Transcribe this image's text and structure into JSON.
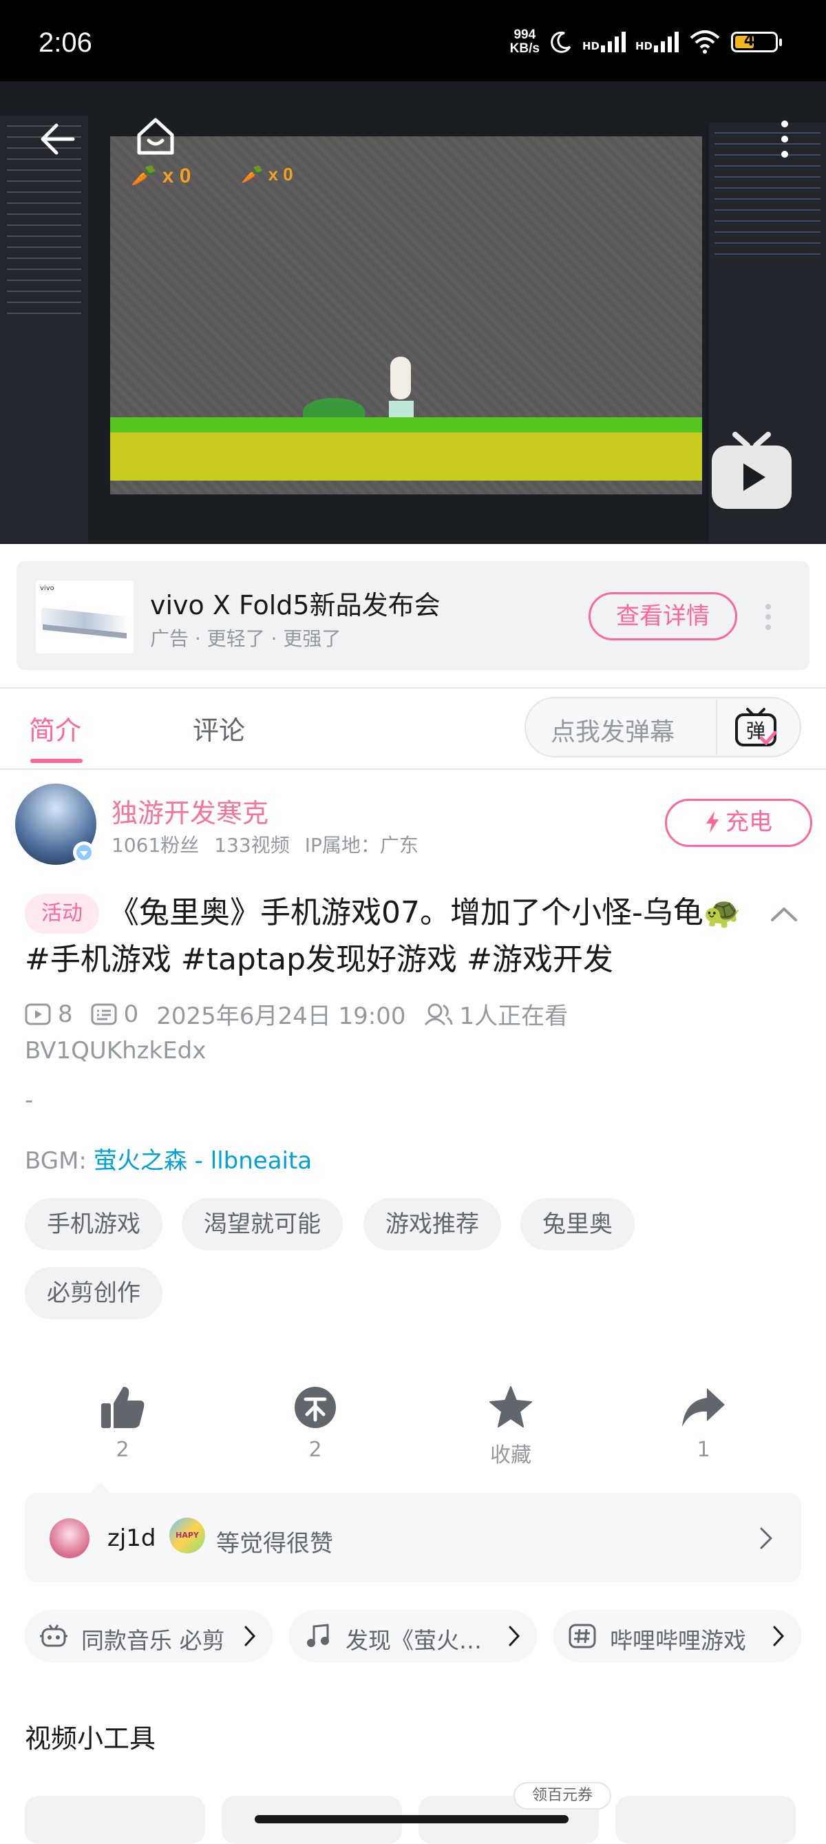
{
  "status_bar": {
    "time": "2:06",
    "net_speed_value": "994",
    "net_speed_unit": "KB/s",
    "hd1": "HD",
    "hd2": "HD",
    "battery": "43",
    "icons": [
      "moon-icon",
      "signal-icon",
      "signal-icon",
      "wifi-icon",
      "battery-icon"
    ]
  },
  "video_overlay": {
    "carrot_count_1": "x 0",
    "carrot_count_2": "x 0",
    "buttons": [
      "back-arrow-icon",
      "home-icon",
      "more-vertical-icon",
      "tv-play-icon"
    ]
  },
  "ad": {
    "title": "vivo X Fold5新品发布会",
    "subtitle": "广告 · 更轻了 · 更强了",
    "button": "查看详情",
    "thumb_label": "vivo"
  },
  "tabs": {
    "intro": "简介",
    "comments": "评论",
    "danmaku_placeholder": "点我发弹幕",
    "danmaku_icon_char": "弹"
  },
  "uploader": {
    "name": "独游开发寒克",
    "fans": "1061粉丝",
    "videos": "133视频",
    "ip": "IP属地：广东",
    "charge_label": "充电"
  },
  "video": {
    "tag": "活动",
    "title": "《兔里奥》手机游戏07。增加了个小怪-乌龟🐢#手机游戏 #taptap发现好游戏 #游戏开发",
    "plays": "8",
    "danmaku_count": "0",
    "date": "2025年6月24日 19:00",
    "watching": "1人正在看",
    "bvid": "BV1QUKhzkEdx",
    "desc": "-",
    "bgm_label": "BGM:",
    "bgm_link": "萤火之森 - llbneaita"
  },
  "tags": [
    "手机游戏",
    "渴望就可能",
    "游戏推荐",
    "兔里奥",
    "必剪创作"
  ],
  "actions": {
    "like": "2",
    "coin": "2",
    "favorite": "收藏",
    "share": "1"
  },
  "likes": {
    "user": "zj1d",
    "badge_text": "HAPY",
    "text": "等觉得很赞"
  },
  "chips": [
    {
      "icon": "robot-icon",
      "text": "同款音乐  必剪"
    },
    {
      "icon": "music-note-icon",
      "text": "发现《萤火之森》"
    },
    {
      "icon": "hashtag-icon",
      "text": "哔哩哔哩游戏"
    }
  ],
  "tools": {
    "title": "视频小工具",
    "coupon": "领百元券"
  },
  "colors": {
    "accent": "#ff6699",
    "link": "#00a1d6",
    "muted": "#9499a0"
  }
}
